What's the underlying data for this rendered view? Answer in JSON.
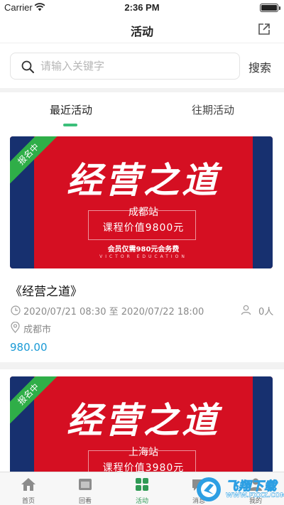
{
  "status_bar": {
    "carrier": "Carrier",
    "time": "2:36 PM"
  },
  "nav": {
    "title": "活动"
  },
  "search": {
    "placeholder": "请输入关键字",
    "button_label": "搜索"
  },
  "tabs": [
    {
      "label": "最近活动",
      "active": true
    },
    {
      "label": "往期活动",
      "active": false
    }
  ],
  "events": [
    {
      "badge": "报名中",
      "banner_title": "经营之道",
      "banner_city": "成都站",
      "banner_price": "课程价值9800元",
      "banner_member": "会员仅需980元会务费",
      "banner_en": "VICTOR EDUCATION",
      "title": "《经营之道》",
      "time": "2020/07/21 08:30 至 2020/07/22 18:00",
      "participants": "0人",
      "city": "成都市",
      "fee": "980.00"
    },
    {
      "badge": "报名中",
      "banner_title": "经营之道",
      "banner_city": "上海站",
      "banner_price": "课程价值3980元"
    }
  ],
  "tab_bar": [
    {
      "label": "首页",
      "icon": "home-icon"
    },
    {
      "label": "回看",
      "icon": "replay-icon"
    },
    {
      "label": "活动",
      "icon": "activity-icon",
      "active": true
    },
    {
      "label": "消息",
      "icon": "message-icon"
    },
    {
      "label": "我的",
      "icon": "profile-icon"
    }
  ],
  "watermark": {
    "text": "飞翔下载",
    "sub": "WWW.FXXZ.COM"
  },
  "colors": {
    "accent_green": "#3bbf7a",
    "price_blue": "#1a9ad6",
    "banner_red": "#d50f22",
    "banner_navy": "#17306f",
    "badge_green": "#2fae48"
  }
}
